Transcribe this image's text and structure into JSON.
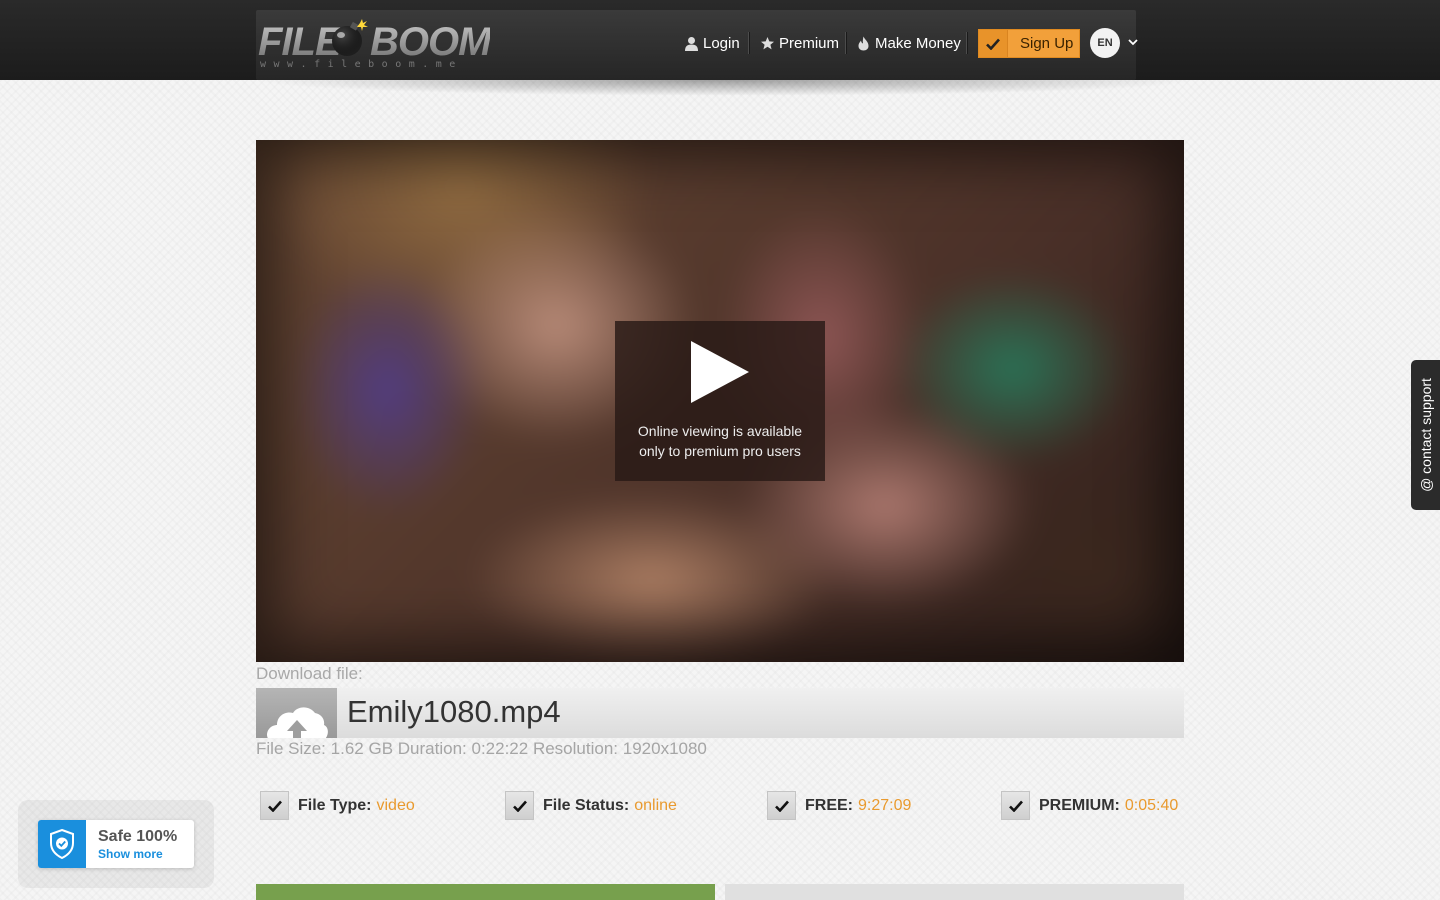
{
  "header": {
    "logo": {
      "word_left": "FILE",
      "word_right": "BOOM",
      "url": "www.fileboom.me"
    },
    "nav": {
      "login": {
        "label": "Login",
        "icon": "user-icon"
      },
      "premium": {
        "label": "Premium",
        "icon": "star-icon"
      },
      "make_money": {
        "label": "Make Money",
        "icon": "fire-icon"
      }
    },
    "signup": {
      "label": "Sign Up",
      "icon": "check-icon"
    },
    "language": {
      "code": "EN",
      "icon": "chevron-down-icon"
    }
  },
  "player": {
    "icon": "play-icon",
    "message_line1": "Online viewing is available",
    "message_line2": "only to premium pro users"
  },
  "download": {
    "label": "Download file:",
    "file_name": "Emily1080.mp4",
    "icon": "cloud-upload-icon",
    "file_size_label": "File Size:",
    "file_size": "1.62 GB",
    "duration_label": "Duration:",
    "duration": "0:22:22",
    "resolution_label": "Resolution:",
    "resolution": "1920x1080"
  },
  "stats": [
    {
      "key": "File Type:",
      "value": "video"
    },
    {
      "key": "File Status:",
      "value": "online"
    },
    {
      "key": "FREE:",
      "value": "9:27:09"
    },
    {
      "key": "PREMIUM:",
      "value": "0:05:40"
    }
  ],
  "safe_widget": {
    "title": "Safe 100%",
    "link": "Show more",
    "icon": "shield-check-icon"
  },
  "support_tab": {
    "label": "@ contact support"
  },
  "colors": {
    "header_bg": "#222222",
    "accent_orange": "#f2a03a",
    "stat_value": "#e99a2e",
    "safe_blue": "#1a8fdd",
    "download_green": "#77a04d"
  }
}
